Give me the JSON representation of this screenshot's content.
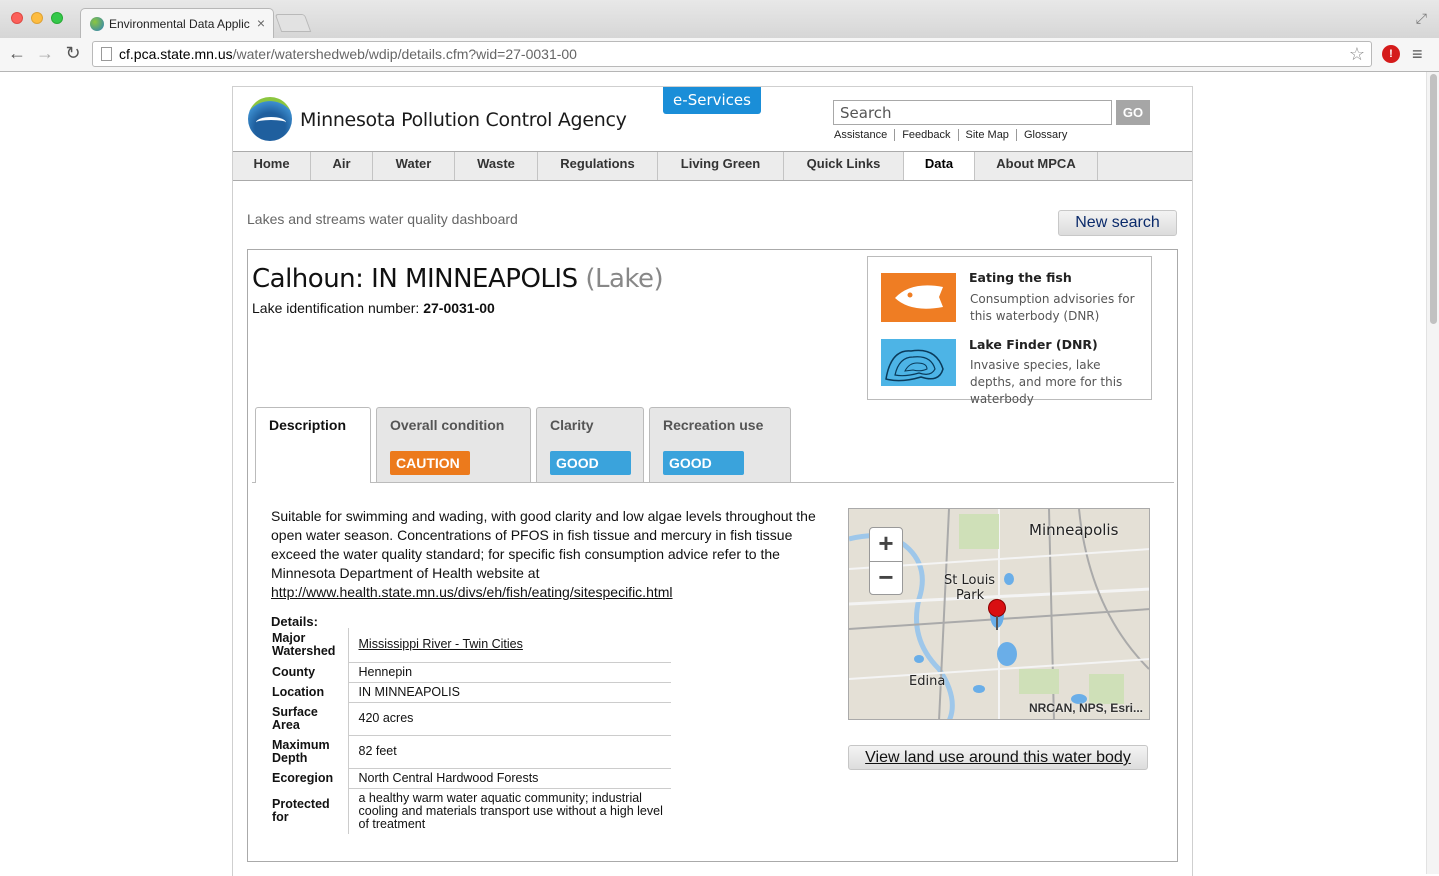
{
  "browser": {
    "tab_title": "Environmental Data Applic",
    "url_host": "cf.pca.state.mn.us",
    "url_path": "/water/watershedweb/wdip/details.cfm?wid=27-0031-00"
  },
  "header": {
    "agency_name": "Minnesota Pollution Control Agency",
    "eservices_label": "e-Services",
    "search_placeholder": "Search",
    "go_label": "GO",
    "util_links": [
      "Assistance",
      "Feedback",
      "Site Map",
      "Glossary"
    ]
  },
  "nav": {
    "items": [
      "Home",
      "Air",
      "Water",
      "Waste",
      "Regulations",
      "Living Green",
      "Quick Links",
      "Data",
      "About MPCA"
    ],
    "active": "Data"
  },
  "page": {
    "subtitle": "Lakes and streams water quality dashboard",
    "new_search_label": "New search"
  },
  "lake": {
    "name": "Calhoun: IN MINNEAPOLIS",
    "type": "(Lake)",
    "id_label": "Lake identification number:",
    "id_value": "27-0031-00"
  },
  "side_links": {
    "fish_title": "Eating the fish",
    "fish_desc": "Consumption advisories for this waterbody (DNR)",
    "finder_title": "Lake Finder (DNR)",
    "finder_desc": "Invasive species, lake depths, and more for this waterbody"
  },
  "tabs": [
    {
      "label": "Description",
      "status": ""
    },
    {
      "label": "Overall condition",
      "status": "CAUTION"
    },
    {
      "label": "Clarity",
      "status": "GOOD"
    },
    {
      "label": "Recreation use",
      "status": "GOOD"
    }
  ],
  "colors": {
    "caution": "#ec7a1c",
    "good": "#3aa3dc",
    "eservices": "#1a8ed8"
  },
  "description": {
    "text": "Suitable for swimming and wading, with good clarity and low algae levels throughout the open water season. Concentrations of PFOS in fish tissue and mercury in fish tissue exceed the water quality standard; for specific fish consumption advice refer to the Minnesota Department of Health website at",
    "link": "http://www.health.state.mn.us/divs/eh/fish/eating/sitespecific.html"
  },
  "details": {
    "heading": "Details:",
    "rows": [
      {
        "key": "Major Watershed",
        "value": "Mississippi River - Twin Cities",
        "link": true
      },
      {
        "key": "County",
        "value": "Hennepin"
      },
      {
        "key": "Location",
        "value": "IN MINNEAPOLIS"
      },
      {
        "key": "Surface Area",
        "value": "420 acres"
      },
      {
        "key": "Maximum Depth",
        "value": "82 feet"
      },
      {
        "key": "Ecoregion",
        "value": "North Central Hardwood Forests"
      },
      {
        "key": "Protected for",
        "value": "a healthy warm water aquatic community; industrial cooling and materials transport use without a high level of treatment"
      }
    ]
  },
  "map": {
    "labels": [
      "Minneapolis",
      "St Louis",
      "Park",
      "Edina"
    ],
    "attribution": "NRCAN, NPS, Esri...",
    "zoom_in": "+",
    "zoom_out": "−",
    "landuse_label": "View land use around this water body"
  }
}
